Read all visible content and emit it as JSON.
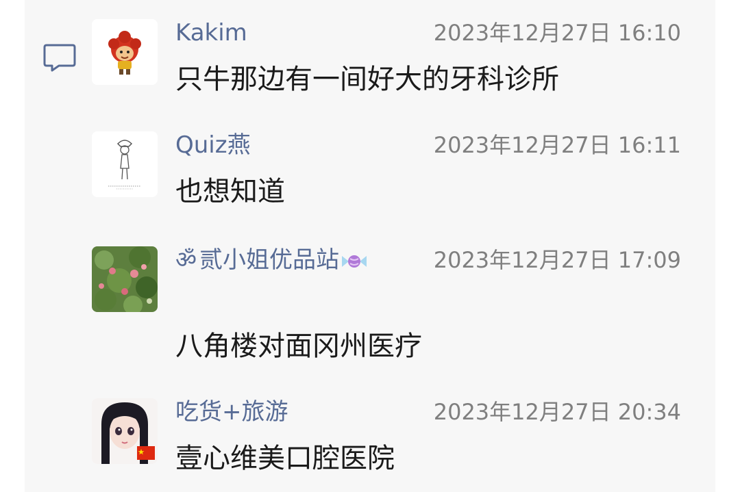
{
  "comments": [
    {
      "name": "Kakim",
      "time": "2023年12月27日 16:10",
      "text": "只牛那边有一间好大的牙科诊所"
    },
    {
      "name": "Quiz燕",
      "time": "2023年12月27日 16:11",
      "text": "也想知道"
    },
    {
      "name_prefix": "ॐ",
      "name": "贰小姐优品站",
      "time": "2023年12月27日 17:09",
      "text": "八角楼对面冈州医疗"
    },
    {
      "name": "吃货+旅游",
      "time": "2023年12月27日 20:34",
      "text": "壹心维美口腔医院"
    }
  ],
  "colors": {
    "name": "#576b95",
    "time": "#7f7f7f",
    "text": "#1a1a1a",
    "panel": "#f7f7f7"
  },
  "icons": {
    "comment": "comment-bubble-icon",
    "candy": "candy-emoji-icon",
    "flag": "china-flag-icon"
  }
}
